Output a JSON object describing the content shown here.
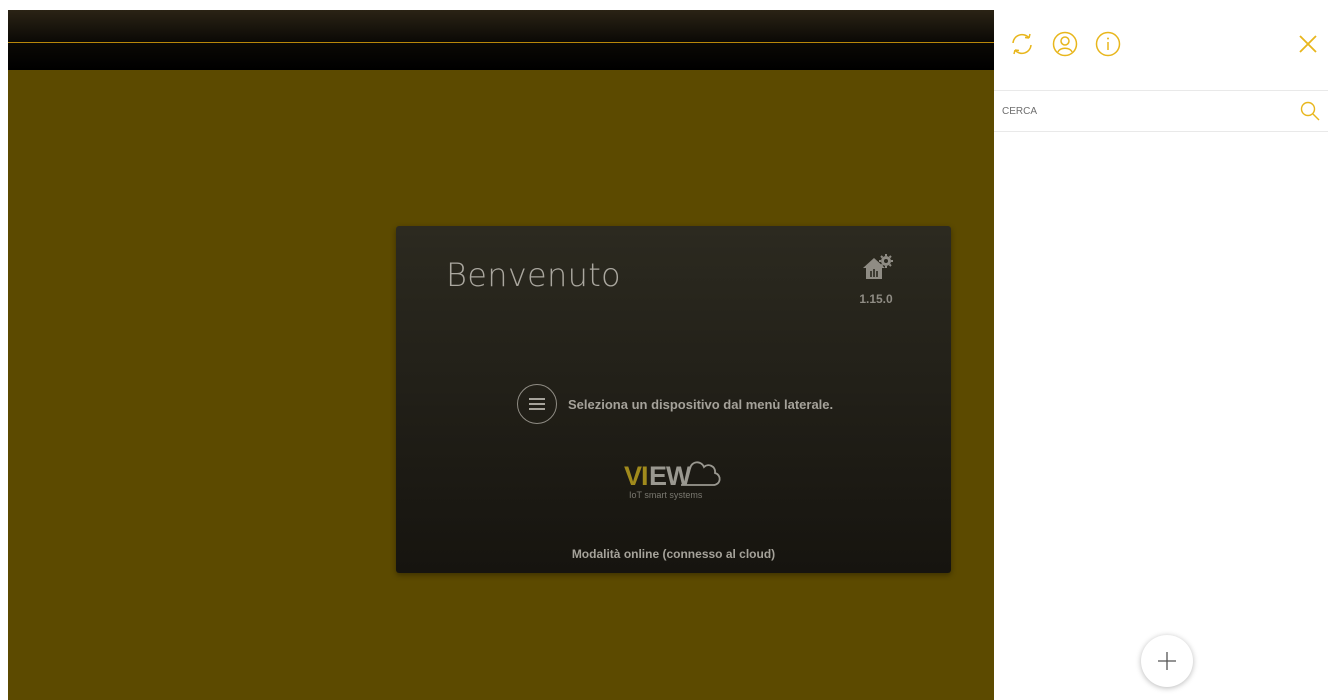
{
  "colors": {
    "accent": "#e8b61c",
    "app_background": "#5c4a00",
    "card_background": "#1c1a14"
  },
  "welcome_card": {
    "title": "Benvenuto",
    "version": "1.15.0",
    "menu_hint": "Seleziona un dispositivo dal menù laterale.",
    "brand": {
      "vi": "VI",
      "ew": "EW",
      "tagline": "IoT smart systems"
    },
    "status": "Modalità online (connesso al cloud)"
  },
  "side_panel": {
    "header_icons": [
      "sync-icon",
      "user-icon",
      "info-icon",
      "close-icon"
    ],
    "search": {
      "placeholder": "CERCA"
    },
    "add_button_icon": "plus-icon"
  }
}
